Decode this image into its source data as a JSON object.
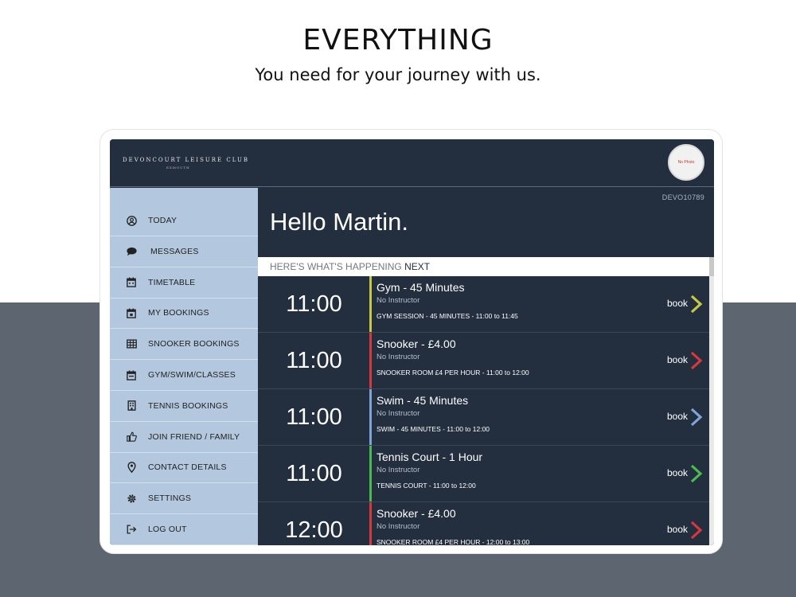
{
  "hero": {
    "title": "EVERYTHING",
    "subtitle": "You need for your journey with us."
  },
  "app": {
    "logo": "DEVONCOURT LEISURE CLUB",
    "logo_sub": "EXMOUTH",
    "avatar_text": "No Photo",
    "member_id": "DEVO10789",
    "greeting": "Hello Martin.",
    "next_prefix": "HERE'S WHAT'S HAPPENING",
    "next_highlight": "NEXT",
    "book_label": "book"
  },
  "sidebar": {
    "items": [
      {
        "label": "TODAY",
        "icon": "user-circle-icon"
      },
      {
        "label": "MESSAGES",
        "icon": "comment-icon"
      },
      {
        "label": "TIMETABLE",
        "icon": "calendar-icon"
      },
      {
        "label": "MY BOOKINGS",
        "icon": "calendar-check-icon"
      },
      {
        "label": "SNOOKER BOOKINGS",
        "icon": "table-grid-icon"
      },
      {
        "label": "GYM/SWIM/CLASSES",
        "icon": "calendar-icon"
      },
      {
        "label": "TENNIS BOOKINGS",
        "icon": "building-icon"
      },
      {
        "label": "JOIN FRIEND / FAMILY",
        "icon": "thumbs-up-icon"
      },
      {
        "label": "CONTACT DETAILS",
        "icon": "map-pin-icon"
      },
      {
        "label": "SETTINGS",
        "icon": "gear-icon"
      },
      {
        "label": "LOG OUT",
        "icon": "logout-icon"
      }
    ]
  },
  "sessions": [
    {
      "time": "11:00",
      "title": "Gym - 45 Minutes",
      "instructor": "No Instructor",
      "detail": "GYM SESSION - 45 MINUTES - 11:00 to 11:45",
      "color": "#c9c845"
    },
    {
      "time": "11:00",
      "title": "Snooker - £4.00",
      "instructor": "No Instructor",
      "detail": "SNOOKER ROOM £4 PER HOUR - 11:00 to 12:00",
      "color": "#d9363e"
    },
    {
      "time": "11:00",
      "title": "Swim - 45 Minutes",
      "instructor": "No Instructor",
      "detail": "SWIM - 45 MINUTES - 11:00 to 12:00",
      "color": "#7ea5d8"
    },
    {
      "time": "11:00",
      "title": "Tennis Court - 1 Hour",
      "instructor": "No Instructor",
      "detail": "TENNIS COURT - 11:00 to 12:00",
      "color": "#4cbb4f"
    },
    {
      "time": "12:00",
      "title": "Snooker - £4.00",
      "instructor": "No Instructor",
      "detail": "SNOOKER ROOM £4 PER HOUR - 12:00 to 13:00",
      "color": "#d9363e"
    }
  ]
}
